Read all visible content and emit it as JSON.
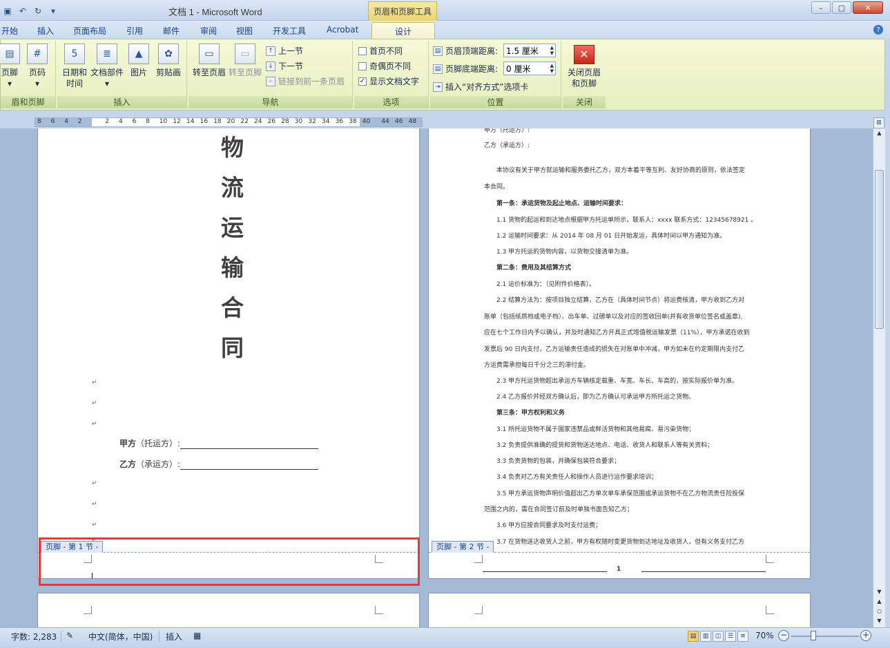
{
  "window": {
    "title": "文档 1 - Microsoft Word",
    "context_tab_title": "页眉和页脚工具"
  },
  "tabs": [
    "开始",
    "插入",
    "页面布局",
    "引用",
    "邮件",
    "审阅",
    "视图",
    "开发工具",
    "Acrobat"
  ],
  "active_tab": "设计",
  "ribbon": {
    "group_hf": {
      "label": "眉和页脚",
      "footer_btn": "页脚",
      "pagenum_btn": "页码"
    },
    "group_insert": {
      "label": "插入",
      "datetime_btn": "日期和时间",
      "docparts_btn": "文档部件",
      "picture_btn": "图片",
      "clipart_btn": "剪贴画"
    },
    "group_nav": {
      "label": "导航",
      "goto_header_btn": "转至页眉",
      "goto_footer_btn": "转至页脚",
      "prev_btn": "上一节",
      "next_btn": "下一节",
      "link_prev_btn": "链接到前一条页眉"
    },
    "group_options": {
      "label": "选项",
      "diff_first": "首页不同",
      "diff_oddeven": "奇偶页不同",
      "show_text": "显示文档文字",
      "show_text_checked": true
    },
    "group_position": {
      "label": "位置",
      "header_dist_label": "页眉顶端距离:",
      "header_dist_value": "1.5 厘米",
      "footer_dist_label": "页脚底端距离:",
      "footer_dist_value": "0 厘米",
      "insert_align_tab": "插入“对齐方式”选项卡"
    },
    "group_close": {
      "label": "关闭",
      "close_btn": "关闭页眉和页脚"
    }
  },
  "ruler_numbers": [
    "8",
    "6",
    "4",
    "2",
    "2",
    "4",
    "6",
    "8",
    "10",
    "12",
    "14",
    "16",
    "18",
    "20",
    "22",
    "24",
    "26",
    "28",
    "30",
    "32",
    "34",
    "36",
    "38",
    "40",
    "44",
    "46",
    "48"
  ],
  "page1": {
    "title_chars": [
      "物",
      "流",
      "运",
      "输",
      "合",
      "同"
    ],
    "party_a_label": "甲方",
    "party_a_role": "（托运方）:",
    "party_b_label": "乙方",
    "party_b_role": "（承运方）:",
    "footer_tag": "页脚 - 第 1 节 -"
  },
  "page2": {
    "footer_tag": "页脚 - 第 2 节 -",
    "page_number": "1",
    "lines": [
      {
        "text": "甲方（托运方）:",
        "style": "flush"
      },
      {
        "text": "乙方（承运方）:",
        "style": "flush"
      },
      {
        "text": "本协议有关于甲方就运输和服务委托乙方，双方本着平等互利、友好协商的原则，依法签定",
        "style": "ind"
      },
      {
        "text": "本合同。",
        "style": "flush"
      },
      {
        "text": "第一条：承运货物及起止地点、运输时间要求：",
        "style": "ind bold"
      },
      {
        "text": "1.1 货物的起运和到达地点根据甲方托运单所示，联系人：xxxx 联系方式：12345678921 。",
        "style": "ind"
      },
      {
        "text": "1.2 运输时间要求：从 2014 年 08 月 01 日开始发运，具体时间以甲方通知为准。",
        "style": "ind"
      },
      {
        "text": "1.3 甲方托运的货物内容，以货物交接清单为准。",
        "style": "ind"
      },
      {
        "text": "第二条：费用及其结算方式",
        "style": "ind bold"
      },
      {
        "text": "2.1 运价标准为：（见附件价格表）。",
        "style": "ind"
      },
      {
        "text": "2.2 结算方法为：按项目独立结算，乙方在（具体时间节点）将运费核清，甲方收到乙方对",
        "style": "ind"
      },
      {
        "text": "账单（包括纸质档或电子档）、出车单、过磅单以及对应的签收回单(并有收货单位签名或盖章),",
        "style": "flush"
      },
      {
        "text": "应在七个工作日内予以确认，并及时通知乙方开具正式增值税运输发票（11%），甲方承诺在收到",
        "style": "flush"
      },
      {
        "text": "发票后 90 日内支付，乙方运输责任造成的损失在对账单中冲减，甲方如未在约定期限内支付乙",
        "style": "flush"
      },
      {
        "text": "方运费需承担每日千分之三的滞付金。",
        "style": "flush"
      },
      {
        "text": "2.3 甲方托运货物超出承运方车辆核定载重、车宽、车长、车高的，按实际报价单为准。",
        "style": "ind"
      },
      {
        "text": "2.4 乙方报价并经双方确认后，即为乙方确认可承运甲方所托运之货物。",
        "style": "ind"
      },
      {
        "text": "第三条：甲方权利和义务",
        "style": "ind bold"
      },
      {
        "text": "3.1 所托运货物不属于国家违禁品或鲜活货物和其他易腐、易污染货物；",
        "style": "ind"
      },
      {
        "text": "3.2 负责提供准确的提货和货物送达地点、电话、收货人和联系人等有关资料；",
        "style": "ind"
      },
      {
        "text": "3.3 负责货物的包装，并确保包装符合要求；",
        "style": "ind"
      },
      {
        "text": "3.4 负责对乙方有关责任人和操作人员进行运作要求培训；",
        "style": "ind"
      },
      {
        "text": "3.5 甲方承运货物声明价值超出乙方单次单车承保范围或承运货物不在乙方物流责任险投保",
        "style": "ind"
      },
      {
        "text": "范围之内的，需在合同签订前及时单独书面告知乙方；",
        "style": "flush"
      },
      {
        "text": "3.6 甲方应按合同要求及时支付运费；",
        "style": "ind"
      },
      {
        "text": "3.7 在货物送达收货人之前，甲方有权随时变更货物到达地址及收货人，但有义务支付乙方",
        "style": "ind"
      }
    ]
  },
  "status": {
    "word_count": "字数: 2,283",
    "language": "中文(简体，中国)",
    "mode": "插入",
    "zoom": "70%"
  }
}
